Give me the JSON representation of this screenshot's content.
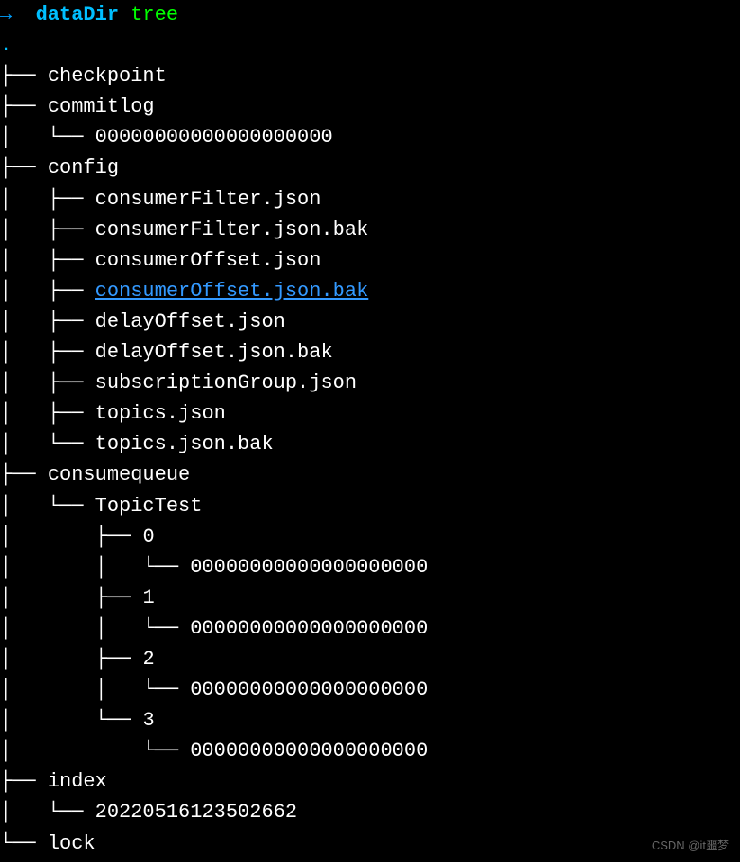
{
  "prompt": {
    "arrow": "→",
    "cwd": "dataDir",
    "command": "tree"
  },
  "root": ".",
  "lines": [
    {
      "prefix": "├── ",
      "name": "checkpoint",
      "class": "file"
    },
    {
      "prefix": "├── ",
      "name": "commitlog",
      "class": "file"
    },
    {
      "prefix": "│   └── ",
      "name": "00000000000000000000",
      "class": "file"
    },
    {
      "prefix": "├── ",
      "name": "config",
      "class": "file"
    },
    {
      "prefix": "│   ├── ",
      "name": "consumerFilter.json",
      "class": "file"
    },
    {
      "prefix": "│   ├── ",
      "name": "consumerFilter.json.bak",
      "class": "file"
    },
    {
      "prefix": "│   ├── ",
      "name": "consumerOffset.json",
      "class": "file"
    },
    {
      "prefix": "│   ├── ",
      "name": "consumerOffset.json.bak",
      "class": "link"
    },
    {
      "prefix": "│   ├── ",
      "name": "delayOffset.json",
      "class": "file"
    },
    {
      "prefix": "│   ├── ",
      "name": "delayOffset.json.bak",
      "class": "file"
    },
    {
      "prefix": "│   ├── ",
      "name": "subscriptionGroup.json",
      "class": "file"
    },
    {
      "prefix": "│   ├── ",
      "name": "topics.json",
      "class": "file"
    },
    {
      "prefix": "│   └── ",
      "name": "topics.json.bak",
      "class": "file"
    },
    {
      "prefix": "├── ",
      "name": "consumequeue",
      "class": "file"
    },
    {
      "prefix": "│   └── ",
      "name": "TopicTest",
      "class": "file"
    },
    {
      "prefix": "│       ├── ",
      "name": "0",
      "class": "file"
    },
    {
      "prefix": "│       │   └── ",
      "name": "00000000000000000000",
      "class": "file"
    },
    {
      "prefix": "│       ├── ",
      "name": "1",
      "class": "file"
    },
    {
      "prefix": "│       │   └── ",
      "name": "00000000000000000000",
      "class": "file"
    },
    {
      "prefix": "│       ├── ",
      "name": "2",
      "class": "file"
    },
    {
      "prefix": "│       │   └── ",
      "name": "00000000000000000000",
      "class": "file"
    },
    {
      "prefix": "│       └── ",
      "name": "3",
      "class": "file"
    },
    {
      "prefix": "│           └── ",
      "name": "00000000000000000000",
      "class": "file"
    },
    {
      "prefix": "├── ",
      "name": "index",
      "class": "file"
    },
    {
      "prefix": "│   └── ",
      "name": "20220516123502662",
      "class": "file"
    },
    {
      "prefix": "└── ",
      "name": "lock",
      "class": "file"
    }
  ],
  "watermark": "CSDN @it噩梦"
}
